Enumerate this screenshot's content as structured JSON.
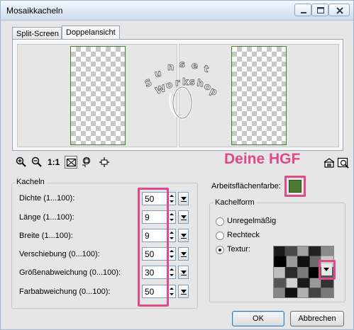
{
  "window": {
    "title": "Mosaikkacheln",
    "controls": {
      "minimize": "minimize-icon",
      "maximize": "maximize-icon",
      "close": "close-icon"
    }
  },
  "tabs": [
    {
      "label": "Split-Screen",
      "active": false
    },
    {
      "label": "Doppelansicht",
      "active": true
    }
  ],
  "preview": {
    "watermark_text": "Sunset Workshop",
    "frame_color": "#4c7a2f"
  },
  "toolbar": {
    "tools": [
      "zoom-in-icon",
      "zoom-out-icon",
      "actual-size-icon",
      "fit-window-icon",
      "zoom-region-icon",
      "pan-icon"
    ],
    "actual_size_label": "1:1",
    "right_tools": [
      "proof-icon",
      "preview-on-image-icon"
    ]
  },
  "annotation": {
    "text": "Deine HGF",
    "color": "#e04a8c"
  },
  "kacheln": {
    "title": "Kacheln",
    "fields": [
      {
        "label": "Dichte (1...100):",
        "value": "50"
      },
      {
        "label": "Länge (1...100):",
        "value": "9"
      },
      {
        "label": "Breite (1...100):",
        "value": "9"
      },
      {
        "label": "Verschiebung (0...100):",
        "value": "50"
      },
      {
        "label": "Größenabweichung (0...100):",
        "value": "30"
      },
      {
        "label": "Farbabweichung (0...100):",
        "value": "50"
      }
    ]
  },
  "arbeitsflaeche": {
    "label": "Arbeitsflächenfarbe:",
    "color": "#4c7a2f"
  },
  "kachelform": {
    "title": "Kachelform",
    "options": [
      {
        "label": "Unregelmäßig",
        "selected": false
      },
      {
        "label": "Rechteck",
        "selected": false
      },
      {
        "label": "Textur:",
        "selected": true
      }
    ]
  },
  "buttons": {
    "ok": "OK",
    "cancel": "Abbrechen"
  }
}
